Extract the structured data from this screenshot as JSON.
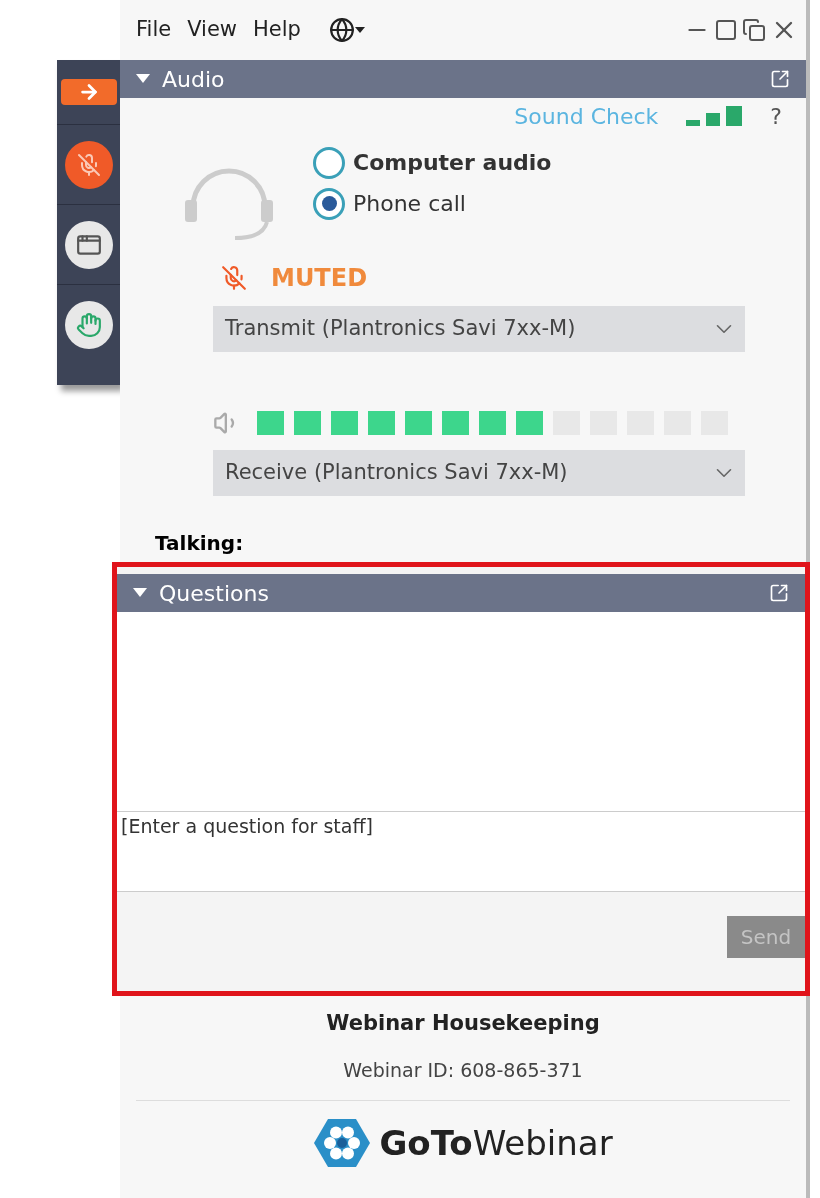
{
  "menu": [
    {
      "label": "File"
    },
    {
      "label": "View"
    },
    {
      "label": "Help"
    }
  ],
  "audio": {
    "title": "Audio",
    "sound_check": "Sound Check",
    "help": "?",
    "muted": true,
    "mic_status": "MUTED",
    "options": [
      {
        "label": "Computer audio",
        "bold": true,
        "selected": false
      },
      {
        "label": "Phone call",
        "bold": false,
        "selected": true
      }
    ],
    "transmit": "Transmit (Plantronics Savi 7xx-M)",
    "speaker_meter": {
      "level": 0.615
    },
    "receive": "Receive (Plantronics Savi 7xx-M)"
  },
  "talking_label": "Talking:",
  "questions": {
    "title": "Questions",
    "placeholder": "[Enter a question for staff]",
    "send": {
      "label": "Send",
      "disabled": true
    }
  },
  "footer": {
    "title": "Webinar Housekeeping",
    "webinar_id": "Webinar ID: 608-865-371"
  },
  "logo": {
    "bold": "GoTo",
    "light": "Webinar"
  }
}
